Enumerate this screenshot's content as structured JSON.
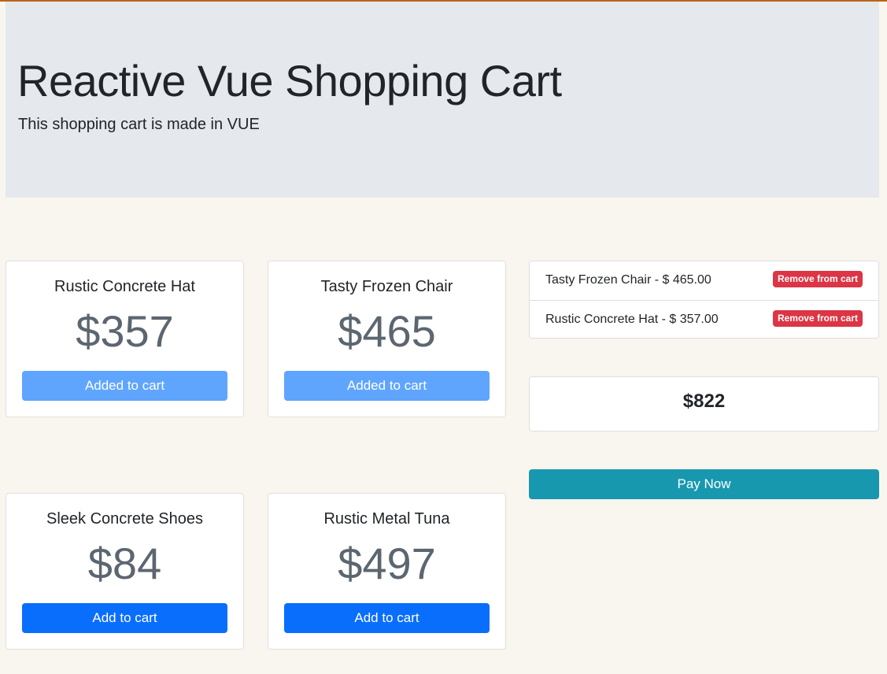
{
  "header": {
    "title": "Reactive Vue Shopping Cart",
    "subtitle": "This shopping cart is made in VUE"
  },
  "products": [
    {
      "name": "Rustic Concrete Hat",
      "price": "$357",
      "button_label": "Added to cart",
      "in_cart": true
    },
    {
      "name": "Tasty Frozen Chair",
      "price": "$465",
      "button_label": "Added to cart",
      "in_cart": true
    },
    {
      "name": "Sleek Concrete Shoes",
      "price": "$84",
      "button_label": "Add to cart",
      "in_cart": false
    },
    {
      "name": "Rustic Metal Tuna",
      "price": "$497",
      "button_label": "Add to cart",
      "in_cart": false
    }
  ],
  "cart": {
    "items": [
      {
        "text": "Tasty Frozen Chair - $ 465.00",
        "remove_label": "Remove from cart"
      },
      {
        "text": "Rustic Concrete Hat - $ 357.00",
        "remove_label": "Remove from cart"
      }
    ],
    "total": "$822",
    "pay_label": "Pay Now"
  },
  "colors": {
    "added_button": "#5fa5fe",
    "add_button": "#0a6efd",
    "remove_button": "#dc3545",
    "pay_button": "#1898ae",
    "jumbotron_bg": "#e5e8ec",
    "page_bg": "#f9f6ef"
  }
}
